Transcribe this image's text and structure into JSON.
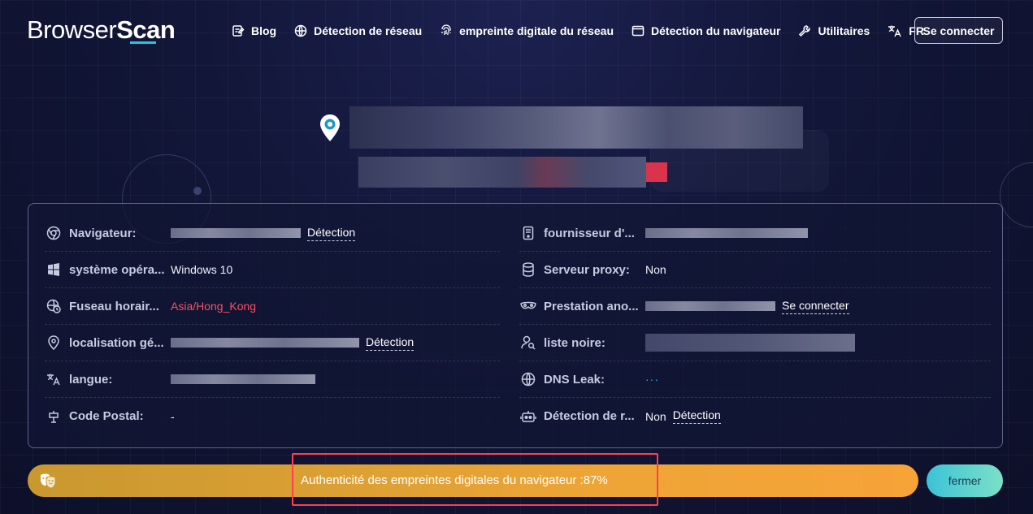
{
  "brand": {
    "name_part1": "Browser",
    "name_part2": "Scan"
  },
  "nav": [
    {
      "label": "Blog",
      "icon": "blog-icon"
    },
    {
      "label": "Détection de réseau",
      "icon": "globe-icon"
    },
    {
      "label": "empreinte digitale du réseau",
      "icon": "fingerprint-icon"
    },
    {
      "label": "Détection du navigateur",
      "icon": "browser-window-icon"
    },
    {
      "label": "Utilitaires",
      "icon": "wrench-icon"
    },
    {
      "label": "FR",
      "icon": "translate-icon"
    }
  ],
  "login_label": "Se connecter",
  "info": {
    "left": [
      {
        "label": "Navigateur:",
        "link": "Détection",
        "icon": "chrome-icon"
      },
      {
        "label": "système opéra...",
        "value": "Windows 10",
        "icon": "windows-icon"
      },
      {
        "label": "Fuseau horair...",
        "value": "Asia/Hong_Kong",
        "icon": "timezone-icon"
      },
      {
        "label": "localisation gé...",
        "link": "Détection",
        "icon": "location-pin-icon"
      },
      {
        "label": "langue:",
        "icon": "translate-icon"
      },
      {
        "label": "Code Postal:",
        "value": "-",
        "icon": "postal-icon"
      }
    ],
    "right": [
      {
        "label": "fournisseur d'...",
        "icon": "server-icon"
      },
      {
        "label": "Serveur proxy:",
        "value": "Non",
        "icon": "database-icon"
      },
      {
        "label": "Prestation ano...",
        "link": "Se connecter",
        "icon": "mask-icon"
      },
      {
        "label": "liste noire:",
        "icon": "user-search-icon"
      },
      {
        "label": "DNS Leak:",
        "value": "···",
        "icon": "dns-globe-icon"
      },
      {
        "label": "Détection de r...",
        "value": "Non",
        "link": "Détection",
        "icon": "robot-icon"
      }
    ]
  },
  "bottom_bar": {
    "text": "Authenticité des empreintes digitales du navigateur :87%",
    "score_percent": 87,
    "close_label": "fermer"
  },
  "colors": {
    "accent": "#23c7d9",
    "bar": "#eea536",
    "highlight": "#ff3f4e",
    "danger": "#ff4d5e"
  }
}
